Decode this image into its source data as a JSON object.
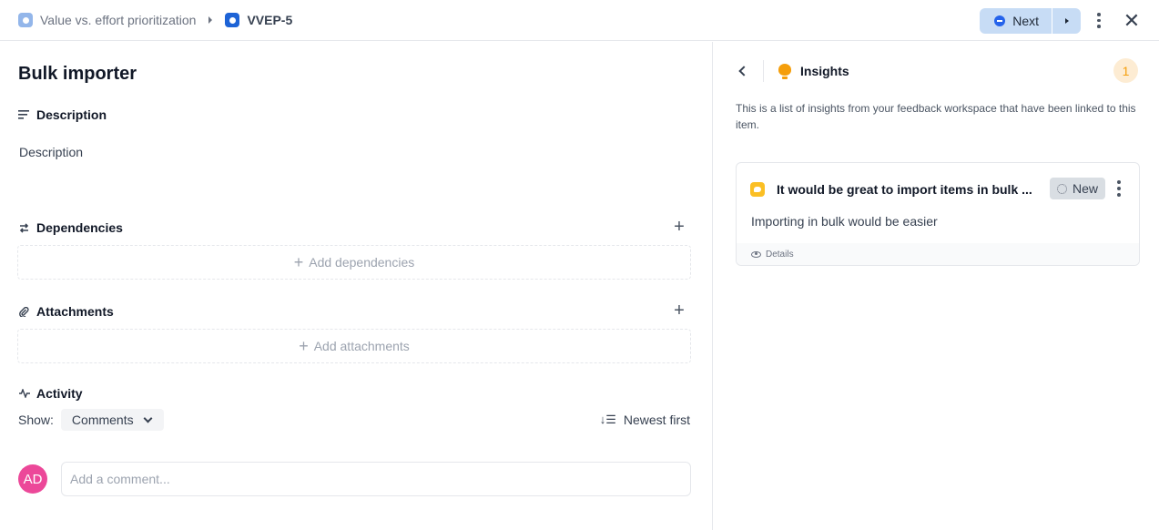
{
  "breadcrumb": {
    "parent": {
      "label": "Value vs. effort prioritization",
      "icon": "project-icon",
      "color": "#93b6ea"
    },
    "separator_icon": "caret-right-icon",
    "current": {
      "label": "VVEP-5",
      "icon": "item-icon",
      "color": "#1d63d6"
    }
  },
  "toolbar": {
    "next_label": "Next",
    "next_icon": "minus-circle-icon",
    "next_menu_icon": "caret-right-icon",
    "more_icon": "kebab-icon",
    "close_icon": "close-icon",
    "close_glyph": "✕"
  },
  "item": {
    "title": "Bulk importer",
    "description": {
      "heading": "Description",
      "text": "Description"
    },
    "dependencies": {
      "heading": "Dependencies",
      "add_icon_glyph": "+",
      "empty_label": "Add dependencies"
    },
    "attachments": {
      "heading": "Attachments",
      "add_icon_glyph": "+",
      "empty_label": "Add attachments"
    },
    "activity": {
      "heading": "Activity",
      "show_label": "Show:",
      "filter_value": "Comments",
      "sort_label": "Newest first",
      "sort_glyph": "↓☰"
    },
    "comment": {
      "avatar_initials": "AD",
      "avatar_color": "#ec4899",
      "placeholder": "Add a comment...",
      "value": ""
    }
  },
  "insights": {
    "title": "Insights",
    "count": "1",
    "description": "This is a list of insights from your feedback workspace that have been linked to this item.",
    "cards": [
      {
        "title": "It would be great to import items in bulk ...",
        "status": "New",
        "body": "Importing in bulk would be easier",
        "footer_label": "Details"
      }
    ]
  },
  "colors": {
    "accent": "#2563eb",
    "next_bg": "#c7dcf5",
    "insight_orange": "#f59e0b",
    "insight_badge_bg": "#fdecd3"
  }
}
